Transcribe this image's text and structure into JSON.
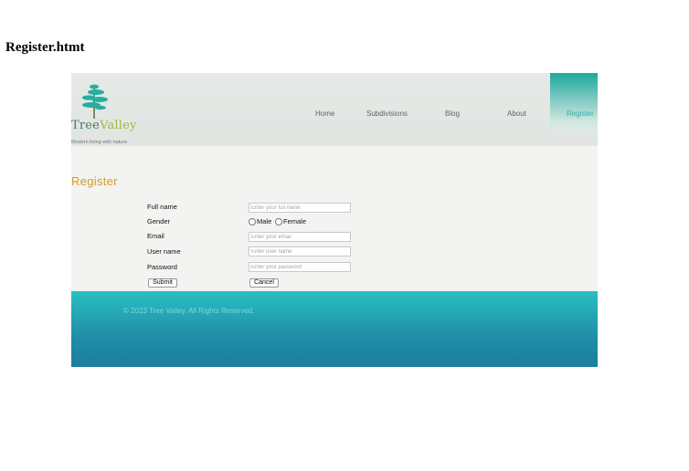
{
  "document": {
    "title": "Register.htmt"
  },
  "header": {
    "logo": {
      "name_part1": "Tree",
      "name_part2": "Valley",
      "tagline": "Modern living with nature"
    },
    "nav": [
      {
        "label": "Home"
      },
      {
        "label": "Subdivisions"
      },
      {
        "label": "Blog"
      },
      {
        "label": "About"
      },
      {
        "label": "Register",
        "active": true
      }
    ]
  },
  "main": {
    "heading": "Register",
    "form": {
      "fullname": {
        "label": "Full name",
        "placeholder": "Enter your full name"
      },
      "gender": {
        "label": "Gender",
        "options": [
          "Male",
          "Female"
        ]
      },
      "email": {
        "label": "Email",
        "placeholder": "Enter your email"
      },
      "username": {
        "label": "User name",
        "placeholder": "Enter user name"
      },
      "password": {
        "label": "Password",
        "placeholder": "Enter your password"
      },
      "submit_label": "Submit",
      "cancel_label": "Cancel"
    }
  },
  "footer": {
    "copyright": "© 2023 Tree Valley. All Rights Reserved."
  },
  "colors": {
    "accent": "#d89a2b",
    "brand_teal": "#2ab2a8",
    "footer_top": "#2abfc4",
    "footer_bottom": "#1b7e9d"
  }
}
